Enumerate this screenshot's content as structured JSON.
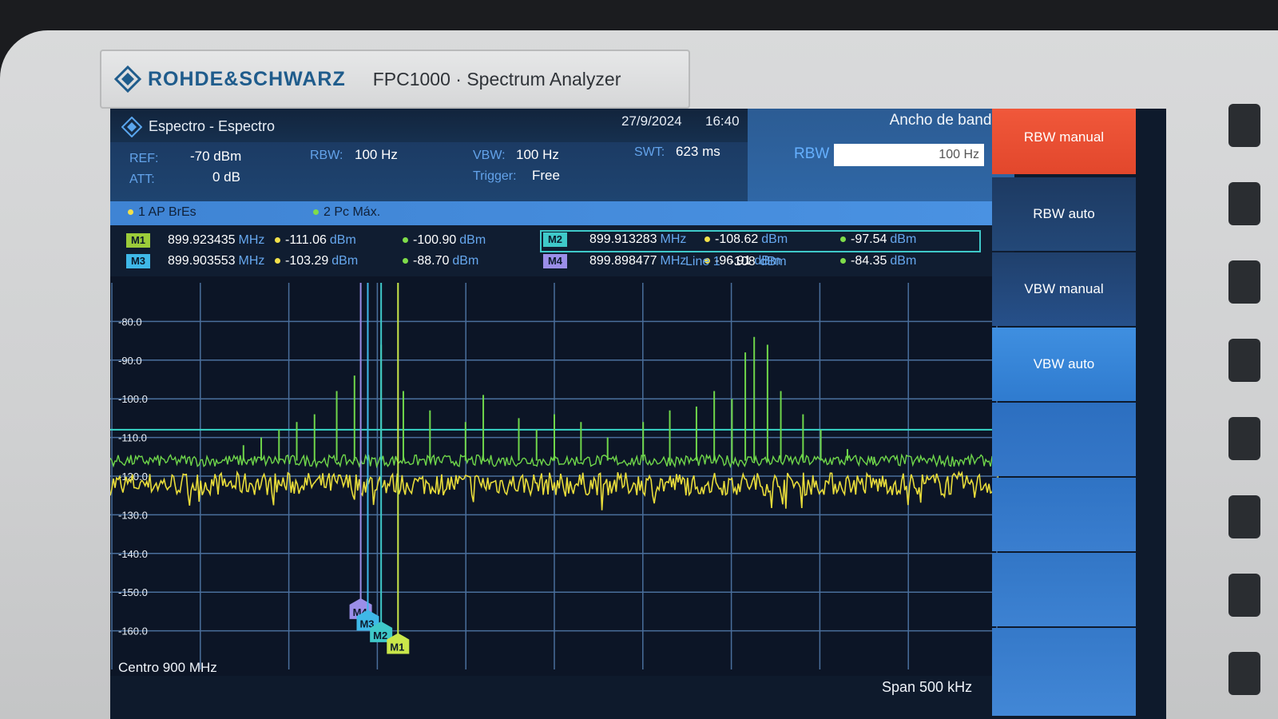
{
  "device": {
    "brand": "ROHDE&SCHWARZ",
    "model": "FPC1000 · Spectrum Analyzer"
  },
  "screen": {
    "title": "Espectro - Espectro",
    "date": "27/9/2024",
    "time": "16:40",
    "settings": {
      "ref_label": "REF:",
      "ref_value": "-70 dBm",
      "att_label": "ATT:",
      "att_value": "0 dB",
      "rbw_label": "RBW:",
      "rbw_value": "100 Hz",
      "vbw_label": "VBW:",
      "vbw_value": "100 Hz",
      "trigger_label": "Trigger:",
      "trigger_value": "Free",
      "swt_label": "SWT:",
      "swt_value": "623 ms"
    },
    "bandwidth_panel": {
      "title": "Ancho de banda",
      "rbw_label": "RBW",
      "rbw_input": "100 Hz"
    },
    "traces": [
      {
        "label": "1 AP BrEs",
        "color": "#f2e04a"
      },
      {
        "label": "2 Pc Máx.",
        "color": "#7fdc4a"
      }
    ],
    "markers": [
      {
        "tag": "M1",
        "freq": "899.923435",
        "unit": "MHz",
        "v1": "-111.06",
        "v2": "-100.90",
        "dbm": "dBm",
        "color": "#c9e64a"
      },
      {
        "tag": "M2",
        "freq": "899.913283",
        "unit": "MHz",
        "v1": "-108.62",
        "v2": "-97.54",
        "dbm": "dBm",
        "color": "#3fc9c9"
      },
      {
        "tag": "M3",
        "freq": "899.903553",
        "unit": "MHz",
        "v1": "-103.29",
        "v2": "-88.70",
        "dbm": "dBm",
        "color": "#3fb8e8"
      },
      {
        "tag": "M4",
        "freq": "899.898477",
        "unit": "MHz",
        "v1": "-96.91",
        "v2": "-84.35",
        "dbm": "dBm",
        "color": "#9b8ee8"
      }
    ],
    "line1": {
      "label": "Line 1",
      "value": "-108",
      "unit": "dBm"
    },
    "footer": {
      "center": "Centro 900 MHz",
      "span": "Span 500 kHz"
    }
  },
  "softkeys": [
    {
      "label": "RBW manual",
      "state": "active"
    },
    {
      "label": "RBW auto",
      "state": "normal"
    },
    {
      "label": "VBW manual",
      "state": "normal"
    },
    {
      "label": "VBW auto",
      "state": "selected"
    }
  ],
  "chart_data": {
    "type": "line",
    "ylim": [
      -170,
      -70
    ],
    "yticks": [
      "-80.0",
      "-90.0",
      "-100.0",
      "-110.0",
      "-120.0",
      "-130.0",
      "-140.0",
      "-150.0",
      "-160.0"
    ],
    "ytick_values": [
      -80,
      -90,
      -100,
      -110,
      -120,
      -130,
      -140,
      -150,
      -160
    ],
    "line1_level": -108,
    "series": [
      {
        "name": "1 AP BrEs",
        "color": "#e8dc3a",
        "noise_floor": -122
      },
      {
        "name": "2 Pc Máx.",
        "color": "#6fd64a",
        "noise_floor": -116,
        "peaks_rel": [
          [
            0.15,
            -112
          ],
          [
            0.17,
            -110
          ],
          [
            0.19,
            -108
          ],
          [
            0.21,
            -106
          ],
          [
            0.23,
            -104
          ],
          [
            0.255,
            -98
          ],
          [
            0.275,
            -94
          ],
          [
            0.29,
            -88
          ],
          [
            0.305,
            -86
          ],
          [
            0.33,
            -98
          ],
          [
            0.36,
            -103
          ],
          [
            0.4,
            -106
          ],
          [
            0.42,
            -99
          ],
          [
            0.46,
            -105
          ],
          [
            0.48,
            -108
          ],
          [
            0.5,
            -104
          ],
          [
            0.53,
            -106
          ],
          [
            0.56,
            -110
          ],
          [
            0.6,
            -106
          ],
          [
            0.63,
            -103
          ],
          [
            0.66,
            -102
          ],
          [
            0.68,
            -98
          ],
          [
            0.7,
            -100
          ],
          [
            0.715,
            -88
          ],
          [
            0.725,
            -84
          ],
          [
            0.74,
            -86
          ],
          [
            0.755,
            -98
          ],
          [
            0.78,
            -104
          ],
          [
            0.8,
            -108
          ],
          [
            0.83,
            -113
          ],
          [
            0.86,
            -115
          ]
        ]
      }
    ]
  }
}
